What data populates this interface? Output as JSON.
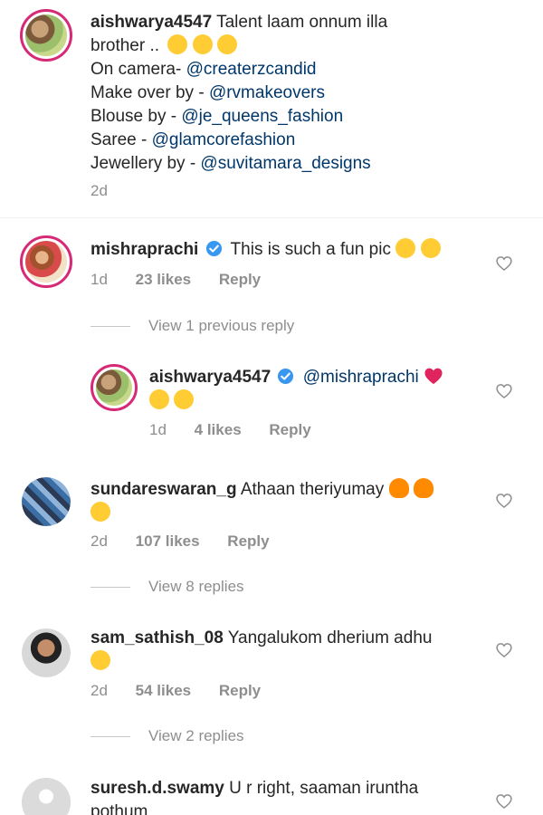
{
  "caption": {
    "username": "aishwarya4547",
    "line1_text": "Talent laam onnum illa",
    "line2_text": "brother ..",
    "line2_emojis": [
      "slightly-frowning-face",
      "slightly-frowning-face",
      "slightly-frowning-face"
    ],
    "credits": [
      {
        "label": "On camera- ",
        "handle": "@createrzcandid"
      },
      {
        "label": "Make over by - ",
        "handle": "@rvmakeovers"
      },
      {
        "label": "Blouse by - ",
        "handle": "@je_queens_fashion"
      },
      {
        "label": "Saree - ",
        "handle": "@glamcorefashion"
      },
      {
        "label": "Jewellery by - ",
        "handle": "@suvitamara_designs"
      }
    ],
    "time": "2d"
  },
  "comments": [
    {
      "username": "mishraprachi",
      "verified": true,
      "text": "This is such a fun pic",
      "emojis": [
        "star-struck-face",
        "face-blowing-kiss"
      ],
      "time": "1d",
      "likes": "23 likes",
      "reply_label": "Reply",
      "view_replies": "View 1 previous reply"
    },
    {
      "username": "aishwarya4547",
      "verified": true,
      "mention": "@mishraprachi",
      "emojis": [
        "red-heart",
        "heart-eyes-face",
        "heart-eyes-face"
      ],
      "time": "1d",
      "likes": "4 likes",
      "reply_label": "Reply"
    },
    {
      "username": "sundareswaran_g",
      "text": "Athaan theriyumay",
      "emojis": [
        "fire",
        "fire",
        "sad-but-relieved-face"
      ],
      "time": "2d",
      "likes": "107 likes",
      "reply_label": "Reply",
      "view_replies": "View 8 replies"
    },
    {
      "username": "sam_sathish_08",
      "text": "Yangalukom dherium adhu",
      "emojis": [
        "face-with-tears-of-joy"
      ],
      "time": "2d",
      "likes": "54 likes",
      "reply_label": "Reply",
      "view_replies": "View 2 replies"
    },
    {
      "username": "suresh.d.swamy",
      "text": "U r right, saaman iruntha",
      "text2": "pothum"
    }
  ],
  "colors": {
    "text": "#262626",
    "mention": "#00376b",
    "meta": "#8e8e8e",
    "verified": "#3897f0",
    "story_ring": "#d62976"
  }
}
